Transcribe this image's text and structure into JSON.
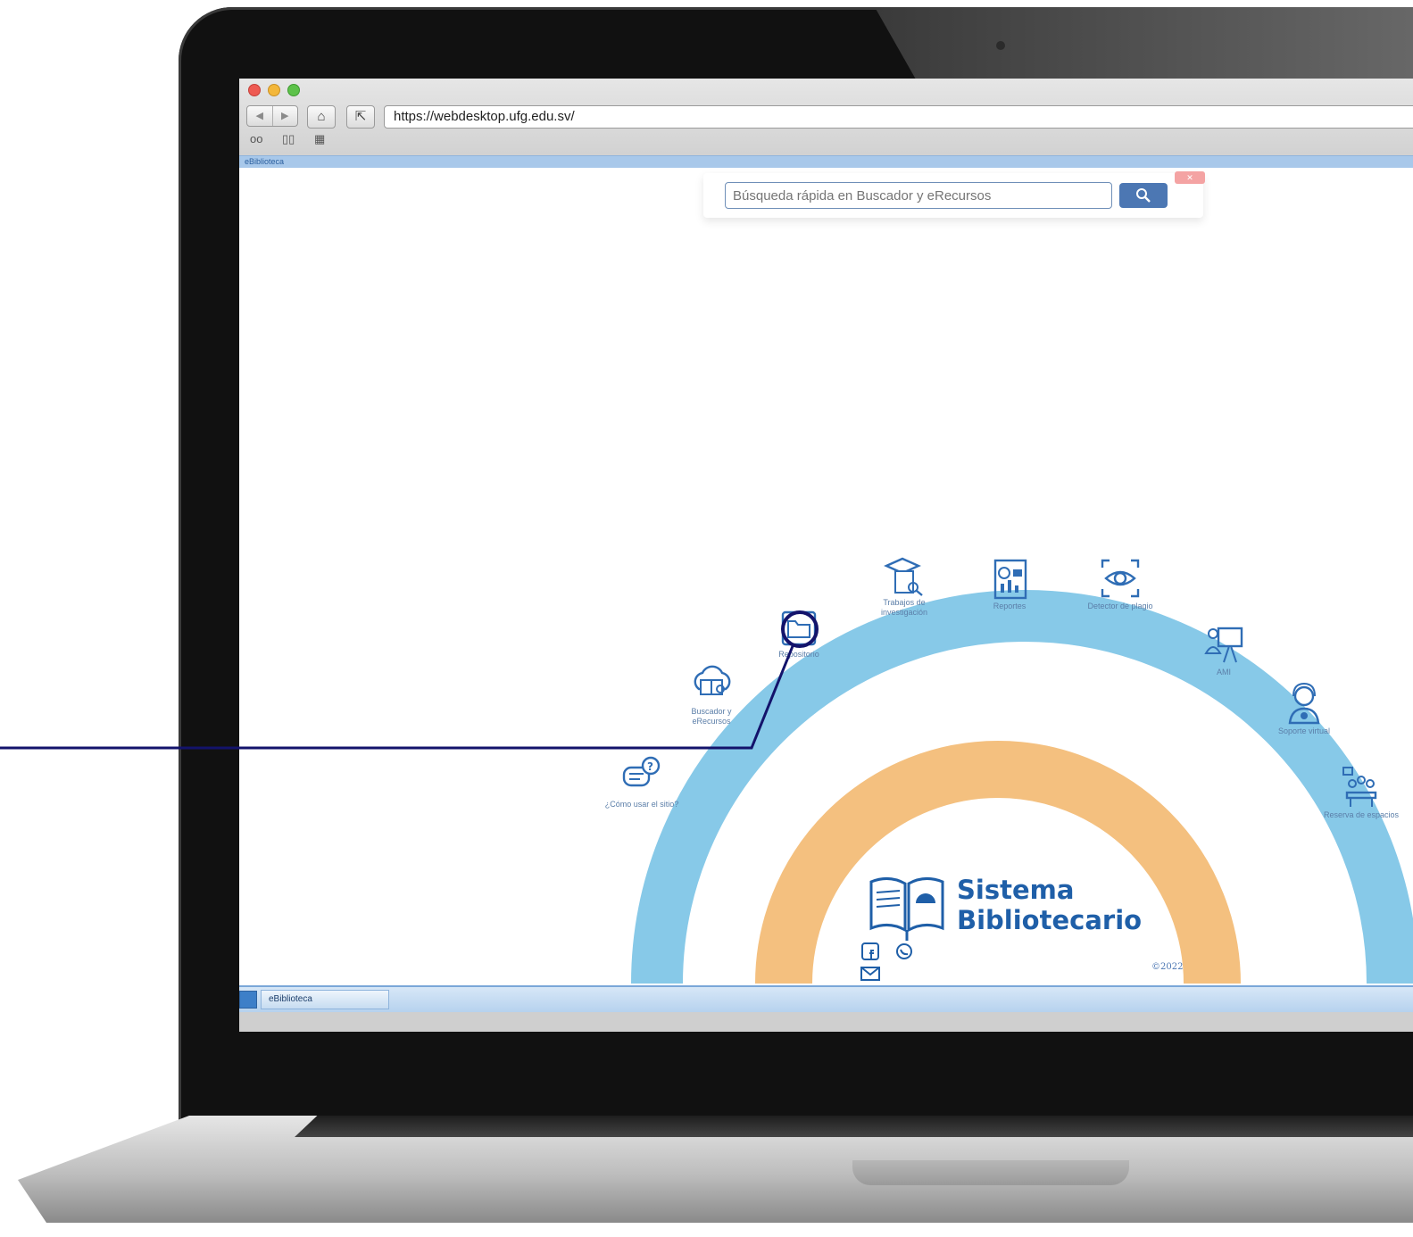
{
  "browser": {
    "url": "https://webdesktop.ufg.edu.sv/",
    "tab_label": "eBiblioteca",
    "back_icon": "back-arrow-icon",
    "forward_icon": "forward-arrow-icon"
  },
  "search": {
    "placeholder": "Búsqueda rápida en Buscador y eRecursos",
    "button_icon": "search-icon"
  },
  "apps": [
    {
      "label": "¿Cómo usar el sitio?",
      "icon": "help-chat-icon"
    },
    {
      "label": "Buscador y eRecursos",
      "icon": "cloud-book-icon"
    },
    {
      "label": "Repositorio",
      "icon": "folder-icon"
    },
    {
      "label": "Trabajos de investigación",
      "icon": "graduation-research-icon"
    },
    {
      "label": "Reportes",
      "icon": "report-icon"
    },
    {
      "label": "Detector de plagio",
      "icon": "eye-scan-icon"
    },
    {
      "label": "AMI",
      "icon": "presentation-icon"
    },
    {
      "label": "Soporte virtual",
      "icon": "support-agent-icon"
    },
    {
      "label": "Reserva de espacios",
      "icon": "meeting-room-icon"
    }
  ],
  "brand": {
    "line1": "Sistema",
    "line2": "Bibliotecario",
    "copyright": "©2022"
  },
  "social": [
    "facebook-icon",
    "whatsapp-icon",
    "mail-icon"
  ],
  "taskbar": {
    "task_label": "eBiblioteca"
  },
  "colors": {
    "outer_arc": "#87c9e8",
    "inner_arc": "#f4c07f",
    "brand_blue": "#1f5fa8",
    "icon_blue": "#2f6db5",
    "callout": "#13136b"
  }
}
